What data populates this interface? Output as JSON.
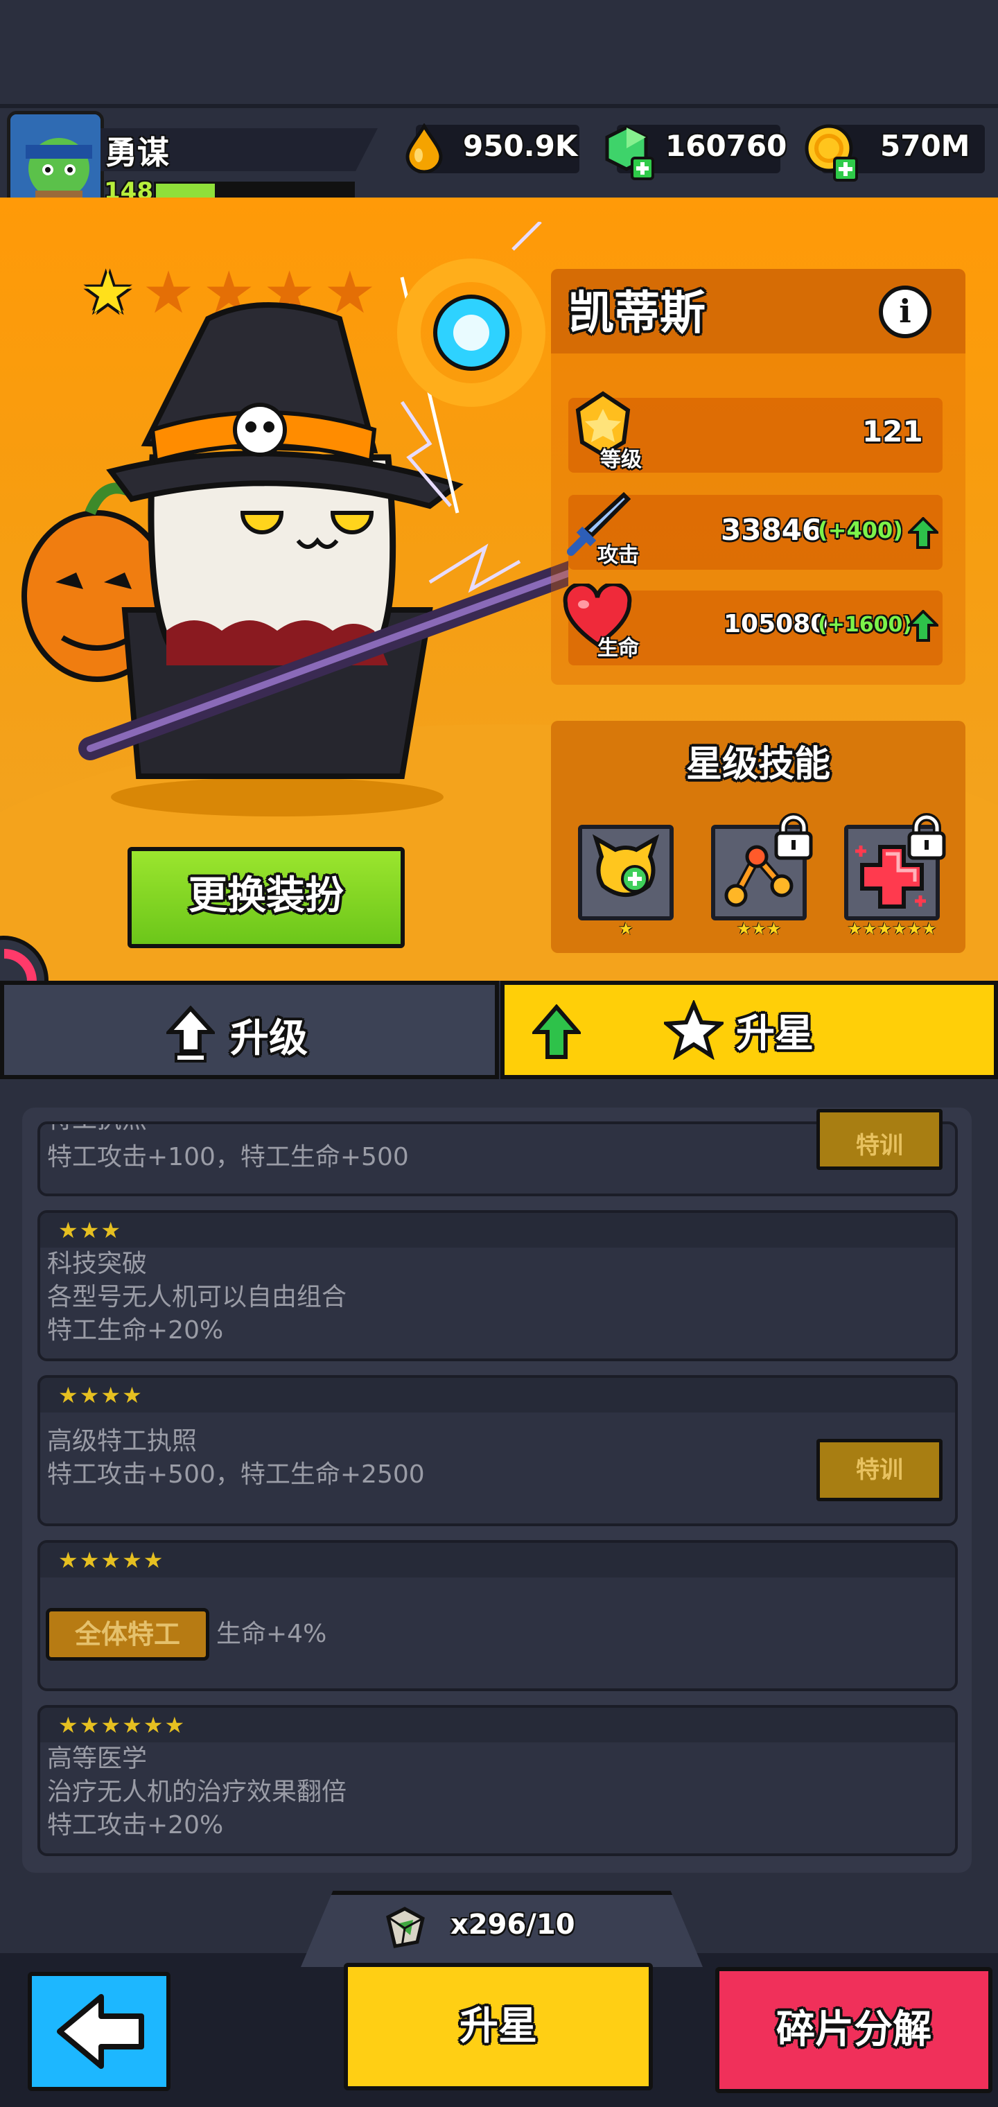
{
  "player": {
    "name": "勇谋",
    "level": "148",
    "xp_fraction": 0.3
  },
  "currencies": [
    {
      "icon": "oil-drop-icon",
      "value": "950.9K"
    },
    {
      "icon": "green-gem-icon",
      "value": "160760"
    },
    {
      "icon": "gold-coin-icon",
      "value": "570M"
    }
  ],
  "hero": {
    "name": "凯蒂斯",
    "stars_filled": 1,
    "stars_total": 5,
    "stats": [
      {
        "icon": "level-badge-icon",
        "label": "等级",
        "value": "121",
        "bonus": ""
      },
      {
        "icon": "sword-icon",
        "label": "攻击",
        "value": "33846",
        "bonus": "(+400)"
      },
      {
        "icon": "heart-icon",
        "label": "生命",
        "value": "105080",
        "bonus": "(+1600)"
      }
    ],
    "skills_title": "星级技能",
    "skills": [
      {
        "icon": "cat-heal-skill-icon",
        "stars": "★",
        "locked": false
      },
      {
        "icon": "drone-link-skill-icon",
        "stars": "★★★",
        "locked": true
      },
      {
        "icon": "medkit-skill-icon",
        "stars": "★★★★★★",
        "locked": true
      }
    ],
    "change_skin_label": "更换装扮"
  },
  "tabs": {
    "upgrade": "升级",
    "star_up": "升星"
  },
  "star_entries": [
    {
      "stars": "",
      "title": "特工执照",
      "lines": [
        "特工攻击+100，特工生命+500"
      ],
      "button": "特训"
    },
    {
      "stars": "★★★",
      "title": "科技突破",
      "lines": [
        "各型号无人机可以自由组合",
        "特工生命+20%"
      ],
      "button": ""
    },
    {
      "stars": "★★★★",
      "title": "高级特工执照",
      "lines": [
        "特工攻击+500，特工生命+2500"
      ],
      "button": "特训"
    },
    {
      "stars": "★★★★★",
      "title": "",
      "badge": "全体特工",
      "lines": [
        "生命+4%"
      ],
      "button": ""
    },
    {
      "stars": "★★★★★★",
      "title": "高等医学",
      "lines": [
        "治疗无人机的治疗效果翻倍",
        "特工攻击+20%"
      ],
      "button": ""
    }
  ],
  "fragments": {
    "icon": "fragment-icon",
    "count": "x296/10"
  },
  "buttons": {
    "star_up": "升星",
    "decompose": "碎片分解"
  },
  "colors": {
    "hero_bg": "#ff9a08",
    "star_tab": "#ffcf08",
    "decompose": "#f0305a",
    "back": "#1db7ff"
  }
}
